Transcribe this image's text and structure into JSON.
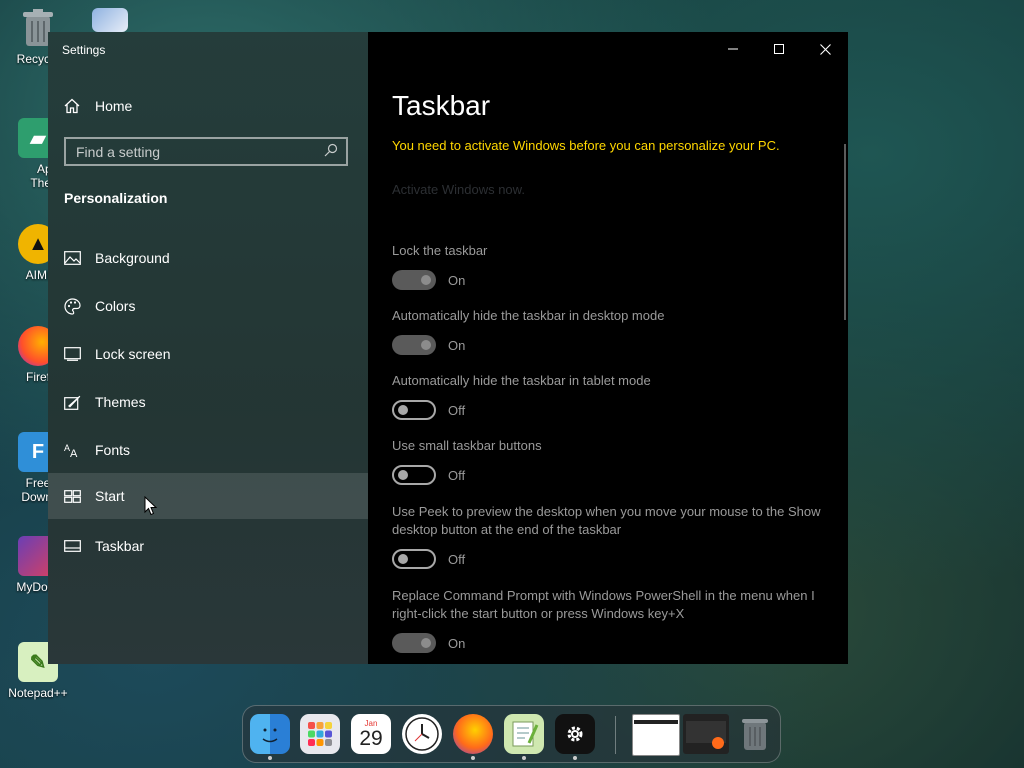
{
  "desktop": {
    "icons": [
      {
        "label": "Recycle"
      },
      {
        "label": "Appl Them"
      },
      {
        "label": "AIMI"
      },
      {
        "label": "Firef"
      },
      {
        "label": "Free Downl"
      },
      {
        "label": "MyDock"
      },
      {
        "label": "Notepad++"
      }
    ]
  },
  "window": {
    "title": "Settings",
    "controls": {
      "minimize": "—",
      "maximize": "☐",
      "close": "✕"
    }
  },
  "sidebar": {
    "home_label": "Home",
    "search_placeholder": "Find a setting",
    "section_title": "Personalization",
    "items": [
      {
        "label": "Background",
        "icon": "image-icon"
      },
      {
        "label": "Colors",
        "icon": "palette-icon"
      },
      {
        "label": "Lock screen",
        "icon": "lock-screen-icon"
      },
      {
        "label": "Themes",
        "icon": "brush-icon"
      },
      {
        "label": "Fonts",
        "icon": "font-icon"
      },
      {
        "label": "Start",
        "icon": "start-icon"
      },
      {
        "label": "Taskbar",
        "icon": "taskbar-icon"
      }
    ],
    "hovered_item": "Start"
  },
  "main": {
    "title": "Taskbar",
    "activation_warning": "You need to activate Windows before you can personalize your PC.",
    "activate_link": "Activate Windows now.",
    "settings": [
      {
        "label": "Lock the taskbar",
        "state": "On"
      },
      {
        "label": "Automatically hide the taskbar in desktop mode",
        "state": "On"
      },
      {
        "label": "Automatically hide the taskbar in tablet mode",
        "state": "Off"
      },
      {
        "label": "Use small taskbar buttons",
        "state": "Off"
      },
      {
        "label": "Use Peek to preview the desktop when you move your mouse to the Show desktop button at the end of the taskbar",
        "state": "Off"
      },
      {
        "label": "Replace Command Prompt with Windows PowerShell in the menu when I right-click the start button or press Windows key+X",
        "state": "On"
      }
    ]
  },
  "dock": {
    "calendar_month": "Jan",
    "calendar_day": "29",
    "items": [
      "finder-icon",
      "launchpad-icon",
      "calendar-icon",
      "clock-icon",
      "firefox-icon",
      "notepad-icon",
      "settings-icon",
      "window-preview-icon",
      "window-preview-icon",
      "trash-icon"
    ]
  },
  "colors": {
    "warning": "#ffd700",
    "accent_sidebar": "#2c4543"
  }
}
